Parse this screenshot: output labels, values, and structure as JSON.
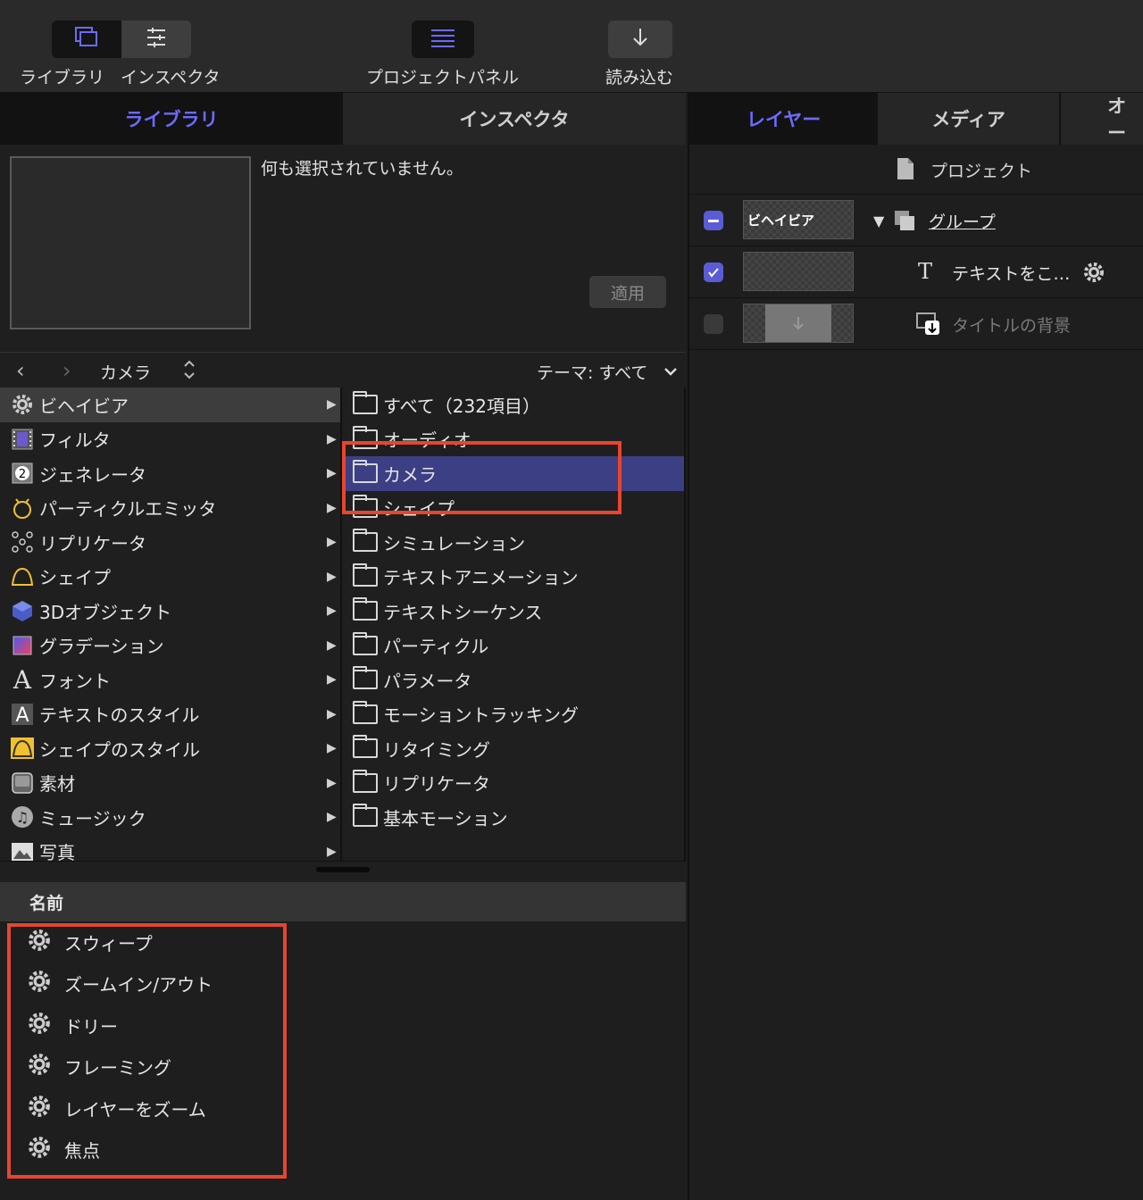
{
  "toolbar": {
    "library_label": "ライブラリ",
    "inspector_label": "インスペクタ",
    "project_panel_label": "プロジェクトパネル",
    "import_label": "読み込む"
  },
  "left_tabs": [
    "ライブラリ",
    "インスペクタ"
  ],
  "preview": {
    "status": "何も選択されていません。",
    "apply": "適用"
  },
  "browser": {
    "path": "カメラ",
    "theme": "テーマ: すべて"
  },
  "categories": [
    "ビヘイビア",
    "フィルタ",
    "ジェネレータ",
    "パーティクルエミッタ",
    "リプリケータ",
    "シェイプ",
    "3Dオブジェクト",
    "グラデーション",
    "フォント",
    "テキストのスタイル",
    "シェイプのスタイル",
    "素材",
    "ミュージック",
    "写真"
  ],
  "subfolders": [
    "すべて（232項目）",
    "オーディオ",
    "カメラ",
    "シェイプ",
    "シミュレーション",
    "テキストアニメーション",
    "テキストシーケンス",
    "パーティクル",
    "パラメータ",
    "モーショントラッキング",
    "リタイミング",
    "リプリケータ",
    "基本モーション"
  ],
  "name_header": "名前",
  "items": [
    "スウィープ",
    "ズームイン/アウト",
    "ドリー",
    "フレーミング",
    "レイヤーをズーム",
    "焦点"
  ],
  "right_tabs": [
    "レイヤー",
    "メディア",
    "オー"
  ],
  "layers": {
    "project": "プロジェクト",
    "group_thumb": "ビヘイビア",
    "group": "グループ",
    "text_layer": "テキストをこ…",
    "title_bg": "タイトルの背景"
  },
  "colors": {
    "accent": "#6b6bff",
    "selection": "#3c3f84",
    "highlight": "#e8452e"
  }
}
